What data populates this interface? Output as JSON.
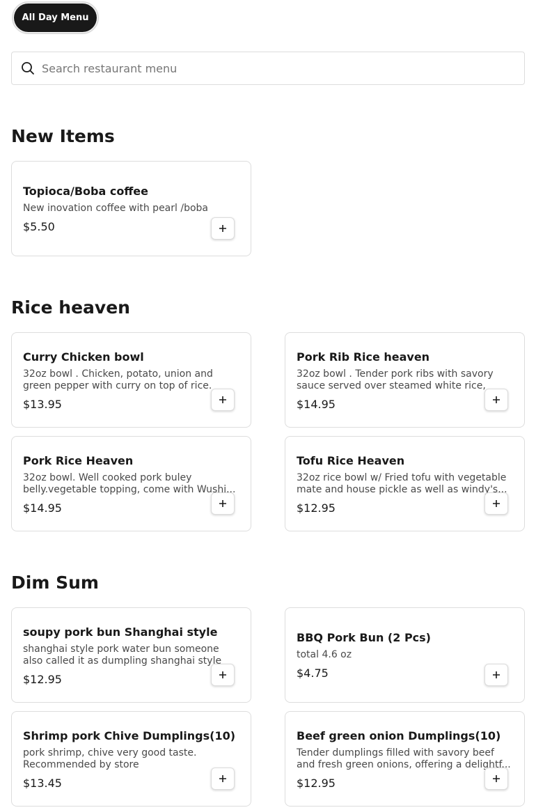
{
  "menu_selector": {
    "label": "All Day Menu"
  },
  "search": {
    "placeholder": "Search restaurant menu",
    "value": ""
  },
  "icons": {
    "search": "search-icon",
    "add": "plus-icon"
  },
  "sections": [
    {
      "title": "New Items",
      "items": [
        {
          "name": "Topioca/Boba coffee",
          "description": "New inovation coffee with pearl /boba",
          "price": "$5.50"
        }
      ]
    },
    {
      "title": "Rice heaven",
      "items": [
        {
          "name": "Curry Chicken bowl",
          "description": "32oz bowl . Chicken, potato, union and green pepper with curry on top of rice.",
          "price": "$13.95"
        },
        {
          "name": "Pork Rib Rice heaven",
          "description": "32oz bowl . Tender pork ribs with savory sauce served over steamed white rice,",
          "price": "$14.95"
        },
        {
          "name": "Pork Rice Heaven",
          "description": "32oz bowl. Well cooked pork buley belly.vegetable topping, come with Wushi...",
          "price": "$14.95"
        },
        {
          "name": "Tofu Rice Heaven",
          "description": "32oz rice bowl w/ Fried tofu with vegetable mate and house pickle as well as windy's...",
          "price": "$12.95"
        }
      ]
    },
    {
      "title": "Dim Sum",
      "items": [
        {
          "name": "soupy pork bun Shanghai style",
          "description": "shanghai style pork water bun someone also called it as dumpling shanghai style",
          "price": "$12.95"
        },
        {
          "name": "BBQ Pork Bun (2 Pcs)",
          "description": "total 4.6 oz",
          "price": "$4.75"
        },
        {
          "name": "Shrimp pork Chive Dumplings(10)",
          "description": "pork shrimp, chive very good taste. Recommended by store",
          "price": "$13.45"
        },
        {
          "name": "Beef green onion Dumplings(10)",
          "description": "Tender dumplings filled with savory beef and fresh green onions, offering a delightf...",
          "price": "$12.95"
        }
      ]
    }
  ]
}
